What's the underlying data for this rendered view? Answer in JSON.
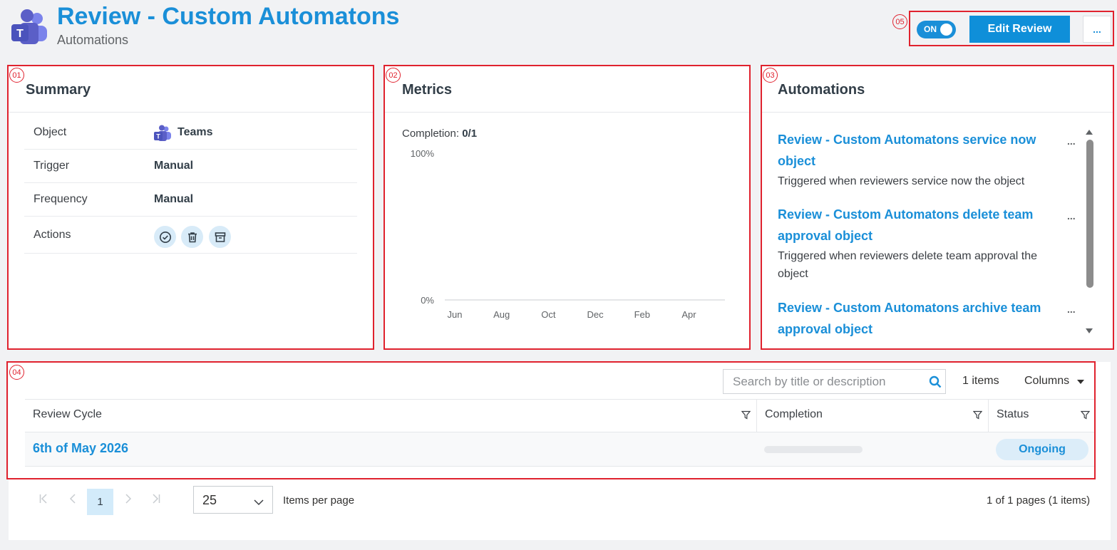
{
  "header": {
    "title": "Review - Custom Automatons",
    "subtitle": "Automations",
    "toggle_label": "ON",
    "edit_button": "Edit Review",
    "more_button": "..."
  },
  "badges": [
    "01",
    "02",
    "03",
    "04",
    "05"
  ],
  "summary": {
    "title": "Summary",
    "rows": [
      {
        "label": "Object",
        "value": "Teams"
      },
      {
        "label": "Trigger",
        "value": "Manual"
      },
      {
        "label": "Frequency",
        "value": "Manual"
      },
      {
        "label": "Actions",
        "value": ""
      }
    ],
    "action_icons": [
      "approve-icon",
      "delete-icon",
      "archive-icon"
    ]
  },
  "metrics": {
    "title": "Metrics",
    "completion_label": "Completion:",
    "completion_value": "0/1"
  },
  "chart_data": {
    "type": "line",
    "x": [
      "Jun",
      "Aug",
      "Oct",
      "Dec",
      "Feb",
      "Apr"
    ],
    "series": [],
    "y_tick_labels": [
      "0%",
      "100%"
    ],
    "ylim": [
      0,
      100
    ],
    "grid": false
  },
  "automations": {
    "title": "Automations",
    "items": [
      {
        "title": "Review - Custom Automatons service now object",
        "desc": "Triggered when reviewers service now the object",
        "menu": "..."
      },
      {
        "title": "Review - Custom Automatons delete team approval object",
        "desc": "Triggered when reviewers delete team approval the object",
        "menu": "..."
      },
      {
        "title": "Review - Custom Automatons archive team approval object",
        "desc": "",
        "menu": "..."
      }
    ]
  },
  "table": {
    "search_placeholder": "Search by title or description",
    "items_count": "1 items",
    "columns_label": "Columns",
    "headers": [
      "Review Cycle",
      "Completion",
      "Status"
    ],
    "rows": [
      {
        "cycle": "6th of May 2026",
        "completion": 0,
        "status": "Ongoing"
      }
    ]
  },
  "pager": {
    "current_page": "1",
    "page_size": "25",
    "items_per_page_label": "Items per page",
    "info": "1 of 1 pages (1 items)"
  },
  "colors": {
    "accent": "#1a8fd8",
    "annotation_red": "#e0222e",
    "background": "#f1f2f4"
  }
}
